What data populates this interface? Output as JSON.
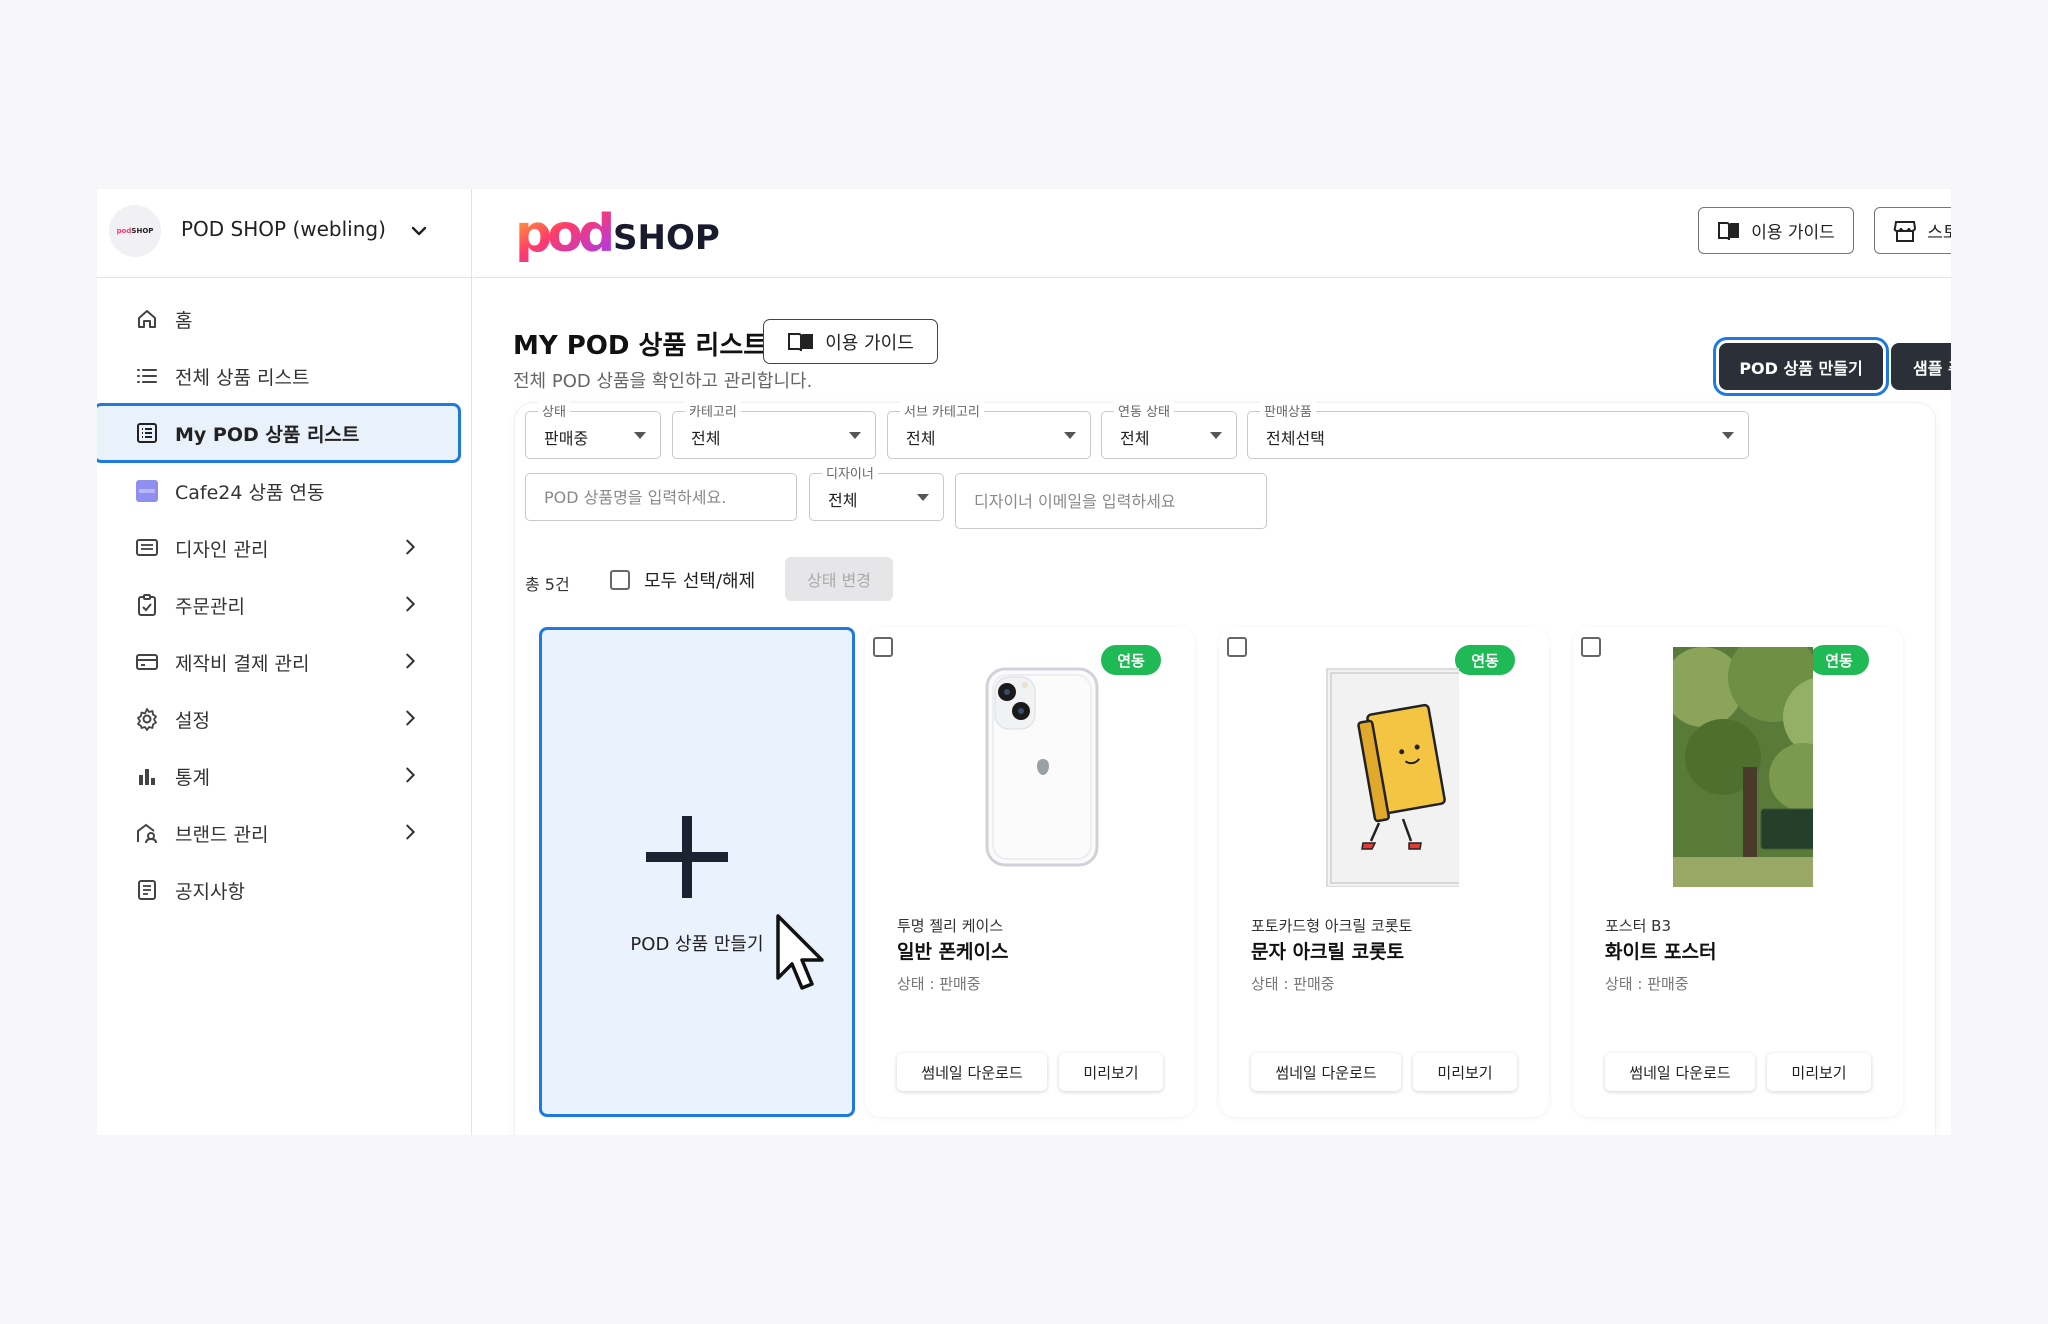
{
  "sidebar": {
    "shop_name": "POD SHOP (webling)",
    "items": [
      {
        "label": "홈"
      },
      {
        "label": "전체 상품 리스트"
      },
      {
        "label": "My POD 상품 리스트"
      },
      {
        "label": "Cafe24 상품 연동"
      },
      {
        "label": "디자인 관리"
      },
      {
        "label": "주문관리"
      },
      {
        "label": "제작비 결제 관리"
      },
      {
        "label": "설정"
      },
      {
        "label": "통계"
      },
      {
        "label": "브랜드 관리"
      },
      {
        "label": "공지사항"
      }
    ]
  },
  "header": {
    "brand_pod": "pod",
    "brand_shop": "SHOP",
    "guide_label": "이용 가이드",
    "store_label": "스토어 관리"
  },
  "main": {
    "title": "MY POD 상품 리스트",
    "subtitle": "전체 POD 상품을 확인하고 관리합니다.",
    "guide_label": "이용 가이드",
    "create_label": "POD 상품 만들기",
    "sample_label": "샘플 주문하기"
  },
  "filters": {
    "status": {
      "label": "상태",
      "value": "판매중"
    },
    "category": {
      "label": "카테고리",
      "value": "전체"
    },
    "subcategory": {
      "label": "서브 카테고리",
      "value": "전체"
    },
    "link": {
      "label": "연동 상태",
      "value": "전체"
    },
    "product": {
      "label": "판매상품",
      "value": "전체선택"
    },
    "search_placeholder": "POD 상품명을 입력하세요.",
    "designer": {
      "label": "디자이너",
      "value": "전체"
    },
    "email_placeholder": "디자이너 이메일을 입력하세요"
  },
  "list": {
    "total": "총 5건",
    "select_all": "모두 선택/해제",
    "state_change": "상태 변경",
    "create_card_label": "POD 상품 만들기",
    "products": [
      {
        "badge": "연동",
        "category": "투명 젤리 케이스",
        "name": "일반 폰케이스",
        "status": "상태 : 판매중",
        "thumb_btn": "썸네일 다운로드",
        "preview_btn": "미리보기"
      },
      {
        "badge": "연동",
        "category": "포토카드형 아크릴 코롯토",
        "name": "문자 아크릴 코롯토",
        "status": "상태 : 판매중",
        "thumb_btn": "썸네일 다운로드",
        "preview_btn": "미리보기"
      },
      {
        "badge": "연동",
        "category": "포스터 B3",
        "name": "화이트 포스터",
        "status": "상태 : 판매중",
        "thumb_btn": "썸네일 다운로드",
        "preview_btn": "미리보기"
      }
    ]
  },
  "colors": {
    "accent": "#1f7ae0",
    "dark_button": "#2a2f38",
    "badge": "#1fb956"
  }
}
